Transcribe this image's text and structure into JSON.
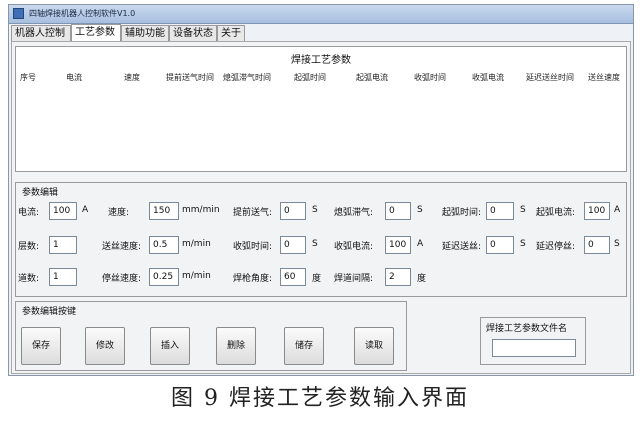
{
  "window": {
    "title": "四轴焊接机器人控制软件V1.0"
  },
  "tabs": [
    {
      "label": "机器人控制"
    },
    {
      "label": "工艺参数"
    },
    {
      "label": "辅助功能"
    },
    {
      "label": "设备状态"
    },
    {
      "label": "关于"
    }
  ],
  "table": {
    "title": "焊接工艺参数",
    "columns": [
      "序号",
      "电流",
      "速度",
      "提前送气时间",
      "熄弧滞气时间",
      "起弧时间",
      "起弧电流",
      "收弧时间",
      "收弧电流",
      "延迟送丝时间",
      "送丝速度"
    ]
  },
  "params": {
    "title": "参数编辑",
    "current": {
      "label": "电流:",
      "value": "100",
      "unit": "A"
    },
    "speed": {
      "label": "速度:",
      "value": "150",
      "unit": "mm/min"
    },
    "pre_gas": {
      "label": "提前送气:",
      "value": "0",
      "unit": "S"
    },
    "arc_gas": {
      "label": "熄弧滞气:",
      "value": "0",
      "unit": "S"
    },
    "arc_start_time": {
      "label": "起弧时间:",
      "value": "0",
      "unit": "S"
    },
    "arc_start_current": {
      "label": "起弧电流:",
      "value": "100",
      "unit": "A"
    },
    "layers": {
      "label": "层数:",
      "value": "1"
    },
    "wire_speed": {
      "label": "送丝速度:",
      "value": "0.5",
      "unit": "m/min"
    },
    "arc_end_time": {
      "label": "收弧时间:",
      "value": "0",
      "unit": "S"
    },
    "arc_end_current": {
      "label": "收弧电流:",
      "value": "100",
      "unit": "A"
    },
    "delay_wire": {
      "label": "延迟送丝:",
      "value": "0",
      "unit": "S"
    },
    "delay_stop": {
      "label": "延迟停丝:",
      "value": "0",
      "unit": "S"
    },
    "passes": {
      "label": "道数:",
      "value": "1"
    },
    "stop_wire_speed": {
      "label": "停丝速度:",
      "value": "0.25",
      "unit": "m/min"
    },
    "torch_angle": {
      "label": "焊枪角度:",
      "value": "60",
      "unit": "度"
    },
    "pass_gap": {
      "label": "焊道间隔:",
      "value": "2",
      "unit": "度"
    }
  },
  "buttons": {
    "title": "参数编辑按键",
    "save": "保存",
    "modify": "修改",
    "insert": "插入",
    "delete": "删除",
    "store": "储存",
    "read": "读取"
  },
  "file": {
    "title": "焊接工艺参数文件名",
    "value": ""
  },
  "caption": "图 9 焊接工艺参数输入界面"
}
